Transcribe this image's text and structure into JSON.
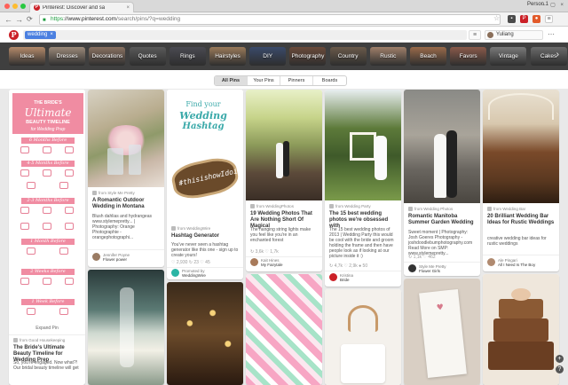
{
  "browser": {
    "tab_title": "Pinterest: Discover and sa",
    "tab_close": "×",
    "profile": "Person 1",
    "window_controls": "– ▢ ×",
    "nav_back": "←",
    "nav_forward": "→",
    "nav_reload": "⟳",
    "url_https": "https",
    "url_host": "://www.pinterest.com",
    "url_path": "/search/pins/?q=wedding",
    "star": "☆"
  },
  "pinterest": {
    "logo": "P",
    "search_chip": "wedding",
    "search_chip_remove": "×",
    "menu_icon": "≡",
    "user_name": "Yuliang",
    "more": "⋯"
  },
  "guides": [
    {
      "label": "Ideas",
      "color": "#b48a6a"
    },
    {
      "label": "Dresses",
      "color": "#9c8a7a"
    },
    {
      "label": "Decorations",
      "color": "#8a7262"
    },
    {
      "label": "Quotes",
      "color": "#5a5a5a"
    },
    {
      "label": "Rings",
      "color": "#4a4a52"
    },
    {
      "label": "Hairstyles",
      "color": "#9a7a5a"
    },
    {
      "label": "DIY",
      "color": "#3a4a6a"
    },
    {
      "label": "Photography",
      "color": "#6a4a3a"
    },
    {
      "label": "Country",
      "color": "#6a5a4a"
    },
    {
      "label": "Rustic",
      "color": "#a0806a"
    },
    {
      "label": "Beach",
      "color": "#9a6a4a"
    },
    {
      "label": "Favors",
      "color": "#8a5a4a"
    },
    {
      "label": "Vintage",
      "color": "#7a7a7a"
    },
    {
      "label": "Cakes",
      "color": "#6a6a6a"
    }
  ],
  "guide_next": "›",
  "filter_tabs": [
    "All Pins",
    "Your Pins",
    "Pinners",
    "Boards"
  ],
  "pins": {
    "p1": {
      "small_title": "THE BRIDE'S",
      "art_line1": "Ultimate",
      "art_line2": "BEAUTY TIMELINE",
      "art_line3": "for Wedding Prep",
      "sections": [
        "6 Months Before",
        "4-5 Months Before",
        "2-3 Months Before",
        "1 Month Before",
        "2 Weeks Before",
        "1 Week Before"
      ],
      "expand": "Expand Pin",
      "source": "from Good Housekeeping",
      "title": "The Bride's Ultimate Beauty Timeline for Wedding Prep",
      "desc": "So, you're engaged. Now what?! Our bridal beauty timeline will get"
    },
    "p2": {
      "source": "from Style Me Pretty",
      "title": "A Romantic Outdoor Wedding in Montana",
      "desc": "Blush dahlias and hydrangeas www.stylemepretty... | Photography: Orange Photographie - orangephotographi...",
      "pinner_name": "Jennifer Poyne",
      "pinner_board": "Flower power"
    },
    "p3": {
      "art_line1": "Find your",
      "art_line2": "Wedding",
      "art_line3": "Hashtag",
      "slab_text": "#thisishowIdoit",
      "source": "from WeddingWire",
      "title": "Hashtag Generator",
      "desc": "You've never seen a hashtag generator like this one - sign up to create yours!",
      "stats": "♡ 2,930  ↻ 23  ♡ 45",
      "promoted_label": "Promoted by",
      "promoted_by": "WeddingWire"
    },
    "p4": {
      "source": "from WeddingPhotos",
      "title": "19 Wedding Photos That Are Nothing Short Of Magical",
      "desc": "The hanging string lights make you feel like you're in an enchanted forest",
      "stats": "↻ 3,6k  ♡ 1,7k",
      "pinner_name": "Kait Hines",
      "pinner_board": "My Fairytale"
    },
    "p5": {
      "source": "from Wedding Party",
      "title": "The 15 best wedding photos we're obsessed with",
      "desc": "The 15 best wedding photos of 2013 | Wedding Party this would be cool with the bride and groom holding the frame and then have people look as if looking at our picture inside it :)",
      "stats": "↻ 4,7k  ♡ 2,9k  ● 50",
      "pinner_name": "Kristina",
      "pinner_board": "Bride"
    },
    "p6": {
      "source": "from Wedding Photos",
      "title": "Romantic Manitoba Summer Garden Wedding",
      "desc": "Sweet moment | Photography: Josh Goeres Photography - joshdoodlebumphotography.com Read More on SMP: www.stylemepretty...",
      "stats": "↻ 1,1k  ♡ 462",
      "pinner_name": "Style Me Pretty",
      "pinner_board": "Flower Girls"
    },
    "p7": {
      "source": "from Wedding Bar",
      "title": "20 Brilliant Wedding Bar Ideas for Rustic Weddings",
      "desc": "creative wedding bar ideas for rustic weddings",
      "stats": "↻ 5k  ♡ 2,1k",
      "pinner_name": "Ale Pingari",
      "pinner_board": "All I Need Is The Boy"
    }
  },
  "colors": {
    "pinterest_red": "#cb2027",
    "chip_blue": "#4a7fe0",
    "guide_bar": "#3f3f3f",
    "grid_bg": "#e9e9e9"
  }
}
